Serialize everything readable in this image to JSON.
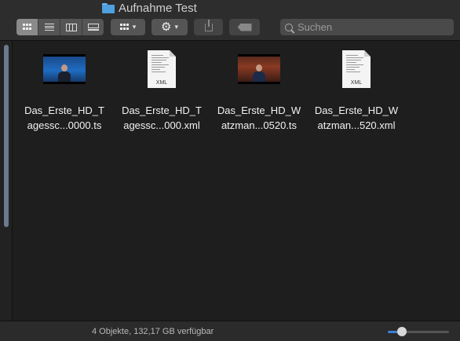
{
  "window": {
    "title": "Aufnahme Test",
    "folder_icon": "folder-icon"
  },
  "toolbar": {
    "view_modes": [
      {
        "name": "icon-view",
        "icon": "grid-icon",
        "active": true
      },
      {
        "name": "list-view",
        "icon": "list-icon",
        "active": false
      },
      {
        "name": "column-view",
        "icon": "columns-icon",
        "active": false
      },
      {
        "name": "gallery-view",
        "icon": "gallery-icon",
        "active": false
      }
    ],
    "group_button_icon": "group-grid-icon",
    "action_button_icon": "gear-icon",
    "share_button_icon": "share-icon",
    "tags_button_icon": "tag-icon",
    "search_placeholder": "Suchen"
  },
  "files": [
    {
      "type": "video",
      "icon": "video-thumbnail",
      "name_line1": "Das_Erste_HD_T",
      "name_line2": "agessc...0000.ts"
    },
    {
      "type": "xml",
      "icon": "xml-document-icon",
      "ext": "XML",
      "name_line1": "Das_Erste_HD_T",
      "name_line2": "agessc...000.xml"
    },
    {
      "type": "video",
      "icon": "video-thumbnail",
      "name_line1": "Das_Erste_HD_W",
      "name_line2": "atzman...0520.ts"
    },
    {
      "type": "xml",
      "icon": "xml-document-icon",
      "ext": "XML",
      "name_line1": "Das_Erste_HD_W",
      "name_line2": "atzman...520.xml"
    }
  ],
  "status": {
    "text": "4 Objekte, 132,17 GB verfügbar",
    "icon_size_level": 0.23
  },
  "colors": {
    "accent": "#3d7fd6",
    "background": "#1e1e1e",
    "toolbar": "#2d2d2d"
  }
}
